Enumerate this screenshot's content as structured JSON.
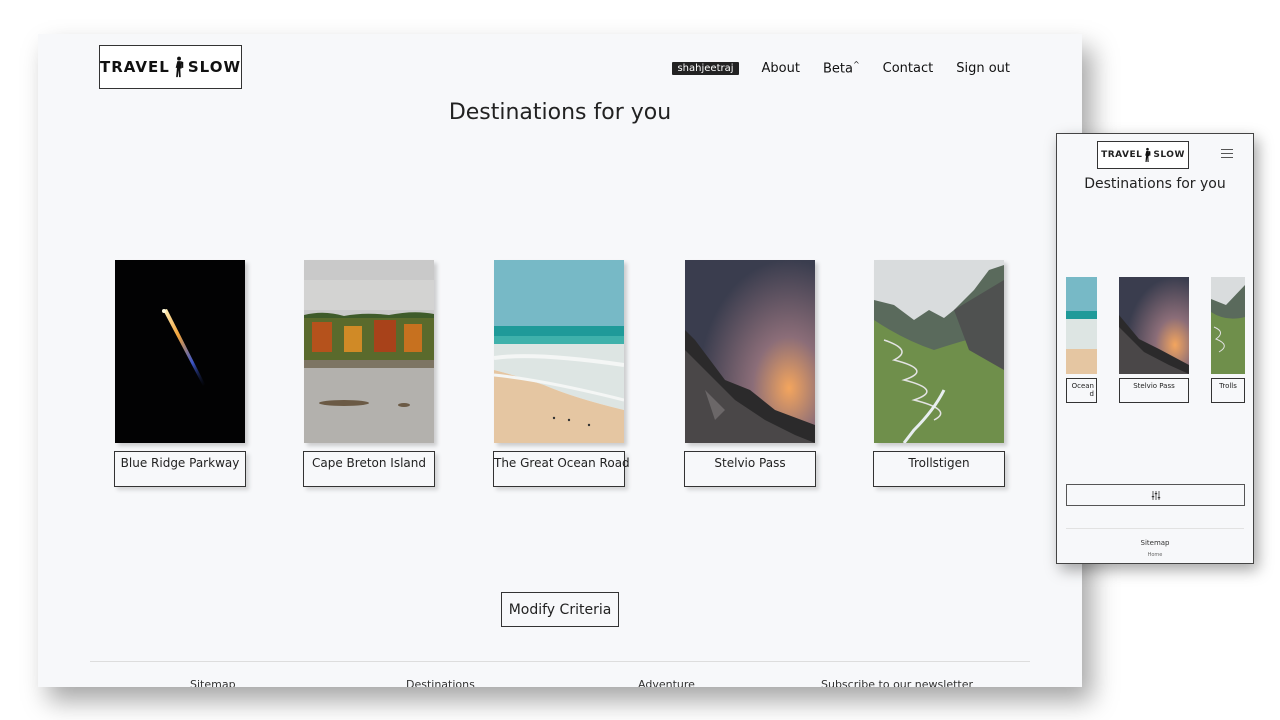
{
  "brand": {
    "left": "TRAVEL",
    "right": "SLOW"
  },
  "nav": {
    "username": "shahjeetraj",
    "about": "About",
    "beta": "Beta",
    "beta_sup": "^",
    "contact": "Contact",
    "signout": "Sign out"
  },
  "page": {
    "title": "Destinations for you"
  },
  "destinations": [
    {
      "name": "Blue Ridge Parkway"
    },
    {
      "name": "Cape Breton Island"
    },
    {
      "name": "The Great Ocean Road"
    },
    {
      "name": "Stelvio Pass"
    },
    {
      "name": "Trollstigen"
    }
  ],
  "actions": {
    "modify_criteria": "Modify Criteria"
  },
  "footer": {
    "sitemap": "Sitemap",
    "destinations": "Destinations",
    "adventure": "Adventure",
    "newsletter": "Subscribe to our newsletter"
  },
  "mobile": {
    "title": "Destinations for you",
    "cards": [
      {
        "name": "Ocean\nd"
      },
      {
        "name": "Stelvio Pass"
      },
      {
        "name": "Trolls"
      }
    ],
    "footer_sitemap": "Sitemap",
    "footer_home": "Home"
  },
  "icons": {
    "walker": "hiker-icon",
    "menu": "hamburger-menu-icon",
    "filter": "sliders-icon"
  }
}
